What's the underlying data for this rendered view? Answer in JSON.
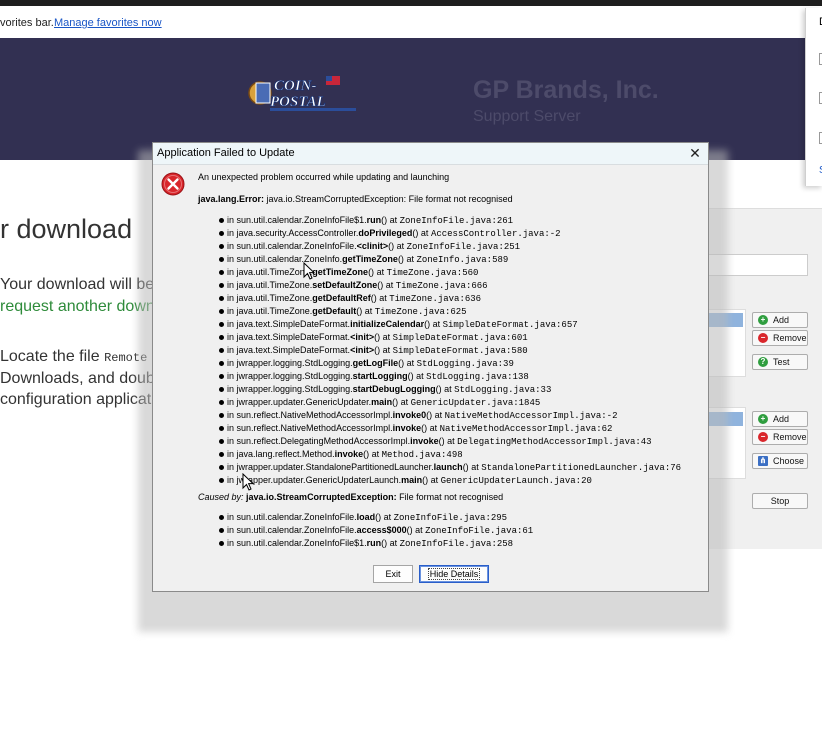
{
  "browser": {
    "favorites_text": "vorites bar.",
    "manage_link": "Manage favorites now"
  },
  "website": {
    "logo_line1": "COIN-",
    "logo_line2": "POSTAL",
    "brand_title": "GP Brands, Inc.",
    "brand_subtitle": "Support Server",
    "heading": "r download",
    "p1": "Your download will be",
    "p2": "request another down",
    "p3a": "Locate the file ",
    "p3b": "Remote",
    "p4": "Downloads, and doub",
    "p5": "configuration applicat"
  },
  "background_panel": {
    "letter": "D",
    "link_letter": "S"
  },
  "config_window": {
    "add1": "Add",
    "remove1": "Remove",
    "test": "Test",
    "add2": "Add",
    "remove2": "Remove",
    "choose": "Choose",
    "stop": "Stop"
  },
  "dialog": {
    "title": "Application Failed to Update",
    "message": "An unexpected problem occurred while updating and launching",
    "error_type": "java.lang.Error:",
    "error_detail": " java.io.StreamCorruptedException: File format not recognised",
    "stack": [
      {
        "p": "sun.util.calendar.ZoneInfoFile$1.",
        "m": "run",
        "loc": "ZoneInfoFile.java:261"
      },
      {
        "p": "java.security.AccessController.",
        "m": "doPrivileged",
        "loc": "AccessController.java:-2"
      },
      {
        "p": "sun.util.calendar.ZoneInfoFile.",
        "m": "<clinit>",
        "loc": "ZoneInfoFile.java:251"
      },
      {
        "p": "sun.util.calendar.ZoneInfo.",
        "m": "getTimeZone",
        "loc": "ZoneInfo.java:589"
      },
      {
        "p": "java.util.TimeZone.",
        "m": "getTimeZone",
        "loc": "TimeZone.java:560"
      },
      {
        "p": "java.util.TimeZone.",
        "m": "setDefaultZone",
        "loc": "TimeZone.java:666"
      },
      {
        "p": "java.util.TimeZone.",
        "m": "getDefaultRef",
        "loc": "TimeZone.java:636"
      },
      {
        "p": "java.util.TimeZone.",
        "m": "getDefault",
        "loc": "TimeZone.java:625"
      },
      {
        "p": "java.text.SimpleDateFormat.",
        "m": "initializeCalendar",
        "loc": "SimpleDateFormat.java:657"
      },
      {
        "p": "java.text.SimpleDateFormat.",
        "m": "<init>",
        "loc": "SimpleDateFormat.java:601"
      },
      {
        "p": "java.text.SimpleDateFormat.",
        "m": "<init>",
        "loc": "SimpleDateFormat.java:580"
      },
      {
        "p": "jwrapper.logging.StdLogging.",
        "m": "getLogFile",
        "loc": "StdLogging.java:39"
      },
      {
        "p": "jwrapper.logging.StdLogging.",
        "m": "startLogging",
        "loc": "StdLogging.java:138"
      },
      {
        "p": "jwrapper.logging.StdLogging.",
        "m": "startDebugLogging",
        "loc": "StdLogging.java:33"
      },
      {
        "p": "jwrapper.updater.GenericUpdater.",
        "m": "main",
        "loc": "GenericUpdater.java:1845"
      },
      {
        "p": "sun.reflect.NativeMethodAccessorImpl.",
        "m": "invoke0",
        "loc": "NativeMethodAccessorImpl.java:-2"
      },
      {
        "p": "sun.reflect.NativeMethodAccessorImpl.",
        "m": "invoke",
        "loc": "NativeMethodAccessorImpl.java:62"
      },
      {
        "p": "sun.reflect.DelegatingMethodAccessorImpl.",
        "m": "invoke",
        "loc": "DelegatingMethodAccessorImpl.java:43"
      },
      {
        "p": "java.lang.reflect.Method.",
        "m": "invoke",
        "loc": "Method.java:498"
      },
      {
        "p": "jwrapper.updater.StandalonePartitionedLauncher.",
        "m": "launch",
        "loc": "StandalonePartitionedLauncher.java:76"
      },
      {
        "p": "jwrapper.updater.GenericUpdaterLaunch.",
        "m": "main",
        "loc": "GenericUpdaterLaunch.java:20"
      }
    ],
    "cause_prefix": "Caused by: ",
    "cause_type": "java.io.StreamCorruptedException:",
    "cause_detail": " File format not recognised",
    "cause_stack": [
      {
        "p": "sun.util.calendar.ZoneInfoFile.",
        "m": "load",
        "loc": "ZoneInfoFile.java:295"
      },
      {
        "p": "sun.util.calendar.ZoneInfoFile.",
        "m": "access$000",
        "loc": "ZoneInfoFile.java:61"
      },
      {
        "p": "sun.util.calendar.ZoneInfoFile$1.",
        "m": "run",
        "loc": "ZoneInfoFile.java:258"
      }
    ],
    "in_word": "in ",
    "call_parens": "()",
    "at_word": " at ",
    "exit_label": "Exit",
    "hide_details_label": "Hide Details"
  },
  "colors": {
    "header_bg": "#323052",
    "link": "#1a56c6",
    "green_text": "#2e8b3a",
    "error_red": "#d9262b",
    "selection_blue": "#8fb3dd"
  },
  "icons": [
    "error-icon",
    "close-icon",
    "add-icon",
    "remove-icon",
    "test-icon",
    "choose-icon",
    "mouse-cursor-icon"
  ]
}
